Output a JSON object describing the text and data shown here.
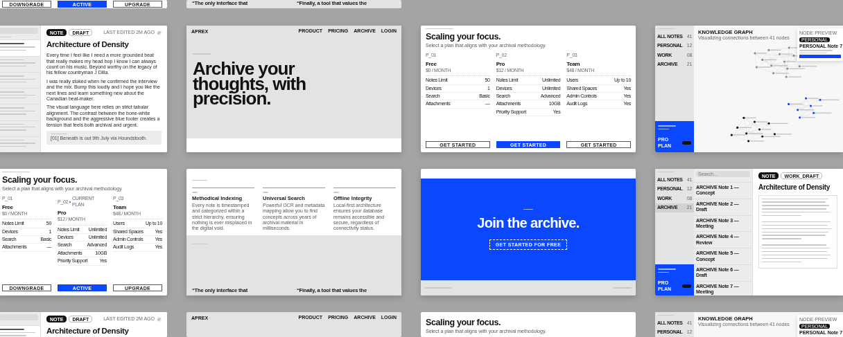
{
  "rows": [
    {
      "cards": [
        {
          "kind": "pricing",
          "plans": [
            {
              "button": {
                "label": "DOWNGRADE",
                "selected": false
              }
            },
            {
              "button": {
                "label": "ACTIVE",
                "selected": true
              }
            },
            {
              "button": {
                "label": "UPGRADE",
                "selected": false
              }
            }
          ]
        },
        {
          "kind": "features",
          "quotes": [
            "“The only interface that",
            "“Finally, a tool that values the"
          ]
        }
      ]
    },
    {
      "cards": [
        {
          "kind": "editor",
          "list": {
            "items": [
              {
                "selected": true
              },
              {
                "selected": false
              },
              {
                "selected": false
              },
              {
                "selected": false
              },
              {
                "selected": false
              },
              {
                "selected": false
              },
              {
                "selected": false
              }
            ]
          },
          "main": {
            "chips": [
              {
                "label": "NOTE",
                "selected": true
              },
              {
                "label": "DRAFT",
                "selected": false
              }
            ],
            "meta": "LAST EDITED 2M AGO",
            "title": "Architecture of Density",
            "boxed": false,
            "paragraphs": [
              "Every time I feel like I need a more grounded beat that really makes my head bop I know I can always count on his music. Beyond worthy on the legacy of his fellow countryman J Dilla.",
              "I was really stoked when he confirmed the interview and the mix. Bump this loudly and I hope you like the next lines and learn something new about the Canadian beat-maker.",
              "The visual language here relies on strict tabular alignment. The contrast between the bone-white background and the aggressive blue footer creates a tension that feels both archival and urgent."
            ],
            "quote": {
              "text": "[01] Beneath is out 9th July via Houndstooth."
            }
          }
        },
        {
          "kind": "hero",
          "logo": "APREX",
          "nav": [
            "PRODUCT",
            "PRICING",
            "ARCHIVE",
            "LOGIN"
          ],
          "headline": "Archive your thoughts, with precision."
        },
        {
          "kind": "pricing",
          "title": "Scaling your focus.",
          "subtitle": "Select a plan that aligns with your archival methodology.",
          "plans": [
            {
              "tag": "P_01",
              "name": "Free",
              "price": "$0 / MONTH",
              "features": [
                {
                  "label": "Notes Limit",
                  "value": "50"
                },
                {
                  "label": "Devices",
                  "value": "1"
                },
                {
                  "label": "Search",
                  "value": "Basic"
                },
                {
                  "label": "Attachments",
                  "value": "—"
                }
              ],
              "button": {
                "label": "GET STARTED",
                "selected": false
              }
            },
            {
              "tag": "P_02",
              "name": "Pro",
              "price": "$12 / MONTH",
              "features": [
                {
                  "label": "Notes Limit",
                  "value": "Unlimited"
                },
                {
                  "label": "Devices",
                  "value": "Unlimited"
                },
                {
                  "label": "Search",
                  "value": "Advanced"
                },
                {
                  "label": "Attachments",
                  "value": "10GB"
                },
                {
                  "label": "Priority Support",
                  "value": "Yes"
                }
              ],
              "button": {
                "label": "GET STARTED",
                "selected": true
              }
            },
            {
              "tag": "P_03",
              "name": "Team",
              "price": "$48 / MONTH",
              "features": [
                {
                  "label": "Users",
                  "value": "Up to 10"
                },
                {
                  "label": "Shared Spaces",
                  "value": "Yes"
                },
                {
                  "label": "Admin Controls",
                  "value": "Yes"
                },
                {
                  "label": "Audit Logs",
                  "value": "Yes"
                }
              ],
              "button": {
                "label": "GET STARTED",
                "selected": false
              }
            }
          ]
        },
        {
          "kind": "graph",
          "nav": {
            "items": [
              {
                "label": "ALL NOTES",
                "count": "41",
                "selected": false
              },
              {
                "label": "PERSONAL",
                "count": "12",
                "selected": false
              },
              {
                "label": "WORK",
                "count": "08",
                "selected": false
              },
              {
                "label": "ARCHIVE",
                "count": "21",
                "selected": false
              }
            ],
            "footer": {
              "plan": "PRO PLAN"
            }
          },
          "title": "KNOWLEDGE GRAPH",
          "subtitle": "Visualizing connections between 41 nodes",
          "preview": {
            "label": "NODE PREVIEW",
            "tag": "PERSONAL",
            "title": "PERSONAL Note 7"
          }
        }
      ]
    },
    {
      "cards": [
        {
          "kind": "pricing",
          "title": "Scaling your focus.",
          "subtitle": "Select a plan that aligns with your archival methodology.",
          "plans": [
            {
              "tag": "P_01",
              "name": "Free",
              "price": "$0 / MONTH",
              "features": [
                {
                  "label": "Notes Limit",
                  "value": "50"
                },
                {
                  "label": "Devices",
                  "value": "1"
                },
                {
                  "label": "Search",
                  "value": "Basic"
                },
                {
                  "label": "Attachments",
                  "value": "—"
                }
              ],
              "button": {
                "label": "DOWNGRADE",
                "selected": false
              }
            },
            {
              "tag": "P_02",
              "current": "CURRENT PLAN",
              "name": "Pro",
              "price": "$12 / MONTH",
              "features": [
                {
                  "label": "Notes Limit",
                  "value": "Unlimited"
                },
                {
                  "label": "Devices",
                  "value": "Unlimited"
                },
                {
                  "label": "Search",
                  "value": "Advanced"
                },
                {
                  "label": "Attachments",
                  "value": "10GB"
                },
                {
                  "label": "Priority Support",
                  "value": "Yes"
                }
              ],
              "button": {
                "label": "ACTIVE",
                "selected": true
              }
            },
            {
              "tag": "P_03",
              "name": "Team",
              "price": "$48 / MONTH",
              "features": [
                {
                  "label": "Users",
                  "value": "Up to 10"
                },
                {
                  "label": "Shared Spaces",
                  "value": "Yes"
                },
                {
                  "label": "Admin Controls",
                  "value": "Yes"
                },
                {
                  "label": "Audit Logs",
                  "value": "Yes"
                }
              ],
              "button": {
                "label": "UPGRADE",
                "selected": false
              }
            }
          ]
        },
        {
          "kind": "features",
          "features": [
            {
              "title": "Methodical Indexing",
              "text": "Every note is timestamped and categorized within a strict hierarchy, ensuring nothing is ever misplaced in the digital void."
            },
            {
              "title": "Universal Search",
              "text": "Powerful OCR and metadata mapping allow you to find concepts across years of archival material in milliseconds."
            },
            {
              "title": "Offline Integrity",
              "text": "Local-first architecture ensures your database remains accessible and secure, regardless of connectivity status."
            }
          ],
          "quotes": [
            "“The only interface that",
            "“Finally, a tool that values the"
          ]
        },
        {
          "kind": "cta",
          "title": "Join the archive.",
          "button": "GET STARTED FOR FREE"
        },
        {
          "kind": "editor",
          "nav": {
            "items": [
              {
                "label": "ALL NOTES",
                "count": "41",
                "selected": false
              },
              {
                "label": "PERSONAL",
                "count": "12",
                "selected": false
              },
              {
                "label": "WORK",
                "count": "08",
                "selected": false
              },
              {
                "label": "ARCHIVE",
                "count": "21",
                "selected": true
              }
            ],
            "footer": {
              "plan": "PRO PLAN"
            }
          },
          "list": {
            "placeholder": "Search...",
            "items": [
              {
                "title": "ARCHIVE Note 1 — Concept",
                "selected": false
              },
              {
                "title": "ARCHIVE Note 2 — Draft",
                "selected": false
              },
              {
                "title": "ARCHIVE Note 3 — Meeting",
                "selected": false
              },
              {
                "title": "ARCHIVE Note 4 — Review",
                "selected": false
              },
              {
                "title": "ARCHIVE Note 5 — Concept",
                "selected": false
              },
              {
                "title": "ARCHIVE Note 6 — Draft",
                "selected": false
              },
              {
                "title": "ARCHIVE Note 7 — Meeting",
                "selected": false
              }
            ]
          },
          "main": {
            "chips": [
              {
                "label": "NOTE",
                "selected": true
              },
              {
                "label": "WORK_DRAFT",
                "selected": false
              }
            ],
            "title": "Architecture of Density",
            "boxed": true
          }
        }
      ]
    },
    {
      "cards": [
        {
          "kind": "editor",
          "list": {
            "items": [
              {
                "selected": true
              }
            ]
          },
          "main": {
            "chips": [
              {
                "label": "NOTE",
                "selected": true
              },
              {
                "label": "DRAFT",
                "selected": false
              }
            ],
            "meta": "LAST EDITED 2M AGO",
            "title": "Architecture of Density"
          }
        },
        {
          "kind": "hero",
          "logo": "APREX",
          "nav": [
            "PRODUCT",
            "PRICING",
            "ARCHIVE",
            "LOGIN"
          ]
        },
        {
          "kind": "pricing",
          "title": "Scaling your focus.",
          "subtitle": "Select a plan that aligns with your archival methodology."
        },
        {
          "kind": "graph",
          "nav": {
            "items": [
              {
                "label": "ALL NOTES",
                "count": "41",
                "selected": false
              },
              {
                "label": "PERSONAL",
                "count": "12",
                "selected": false
              }
            ]
          },
          "title": "KNOWLEDGE GRAPH",
          "subtitle": "Visualizing connections between 41 nodes",
          "preview": {
            "label": "NODE PREVIEW",
            "tag": "PERSONAL",
            "title": "PERSONAL Note 7"
          }
        }
      ]
    }
  ]
}
